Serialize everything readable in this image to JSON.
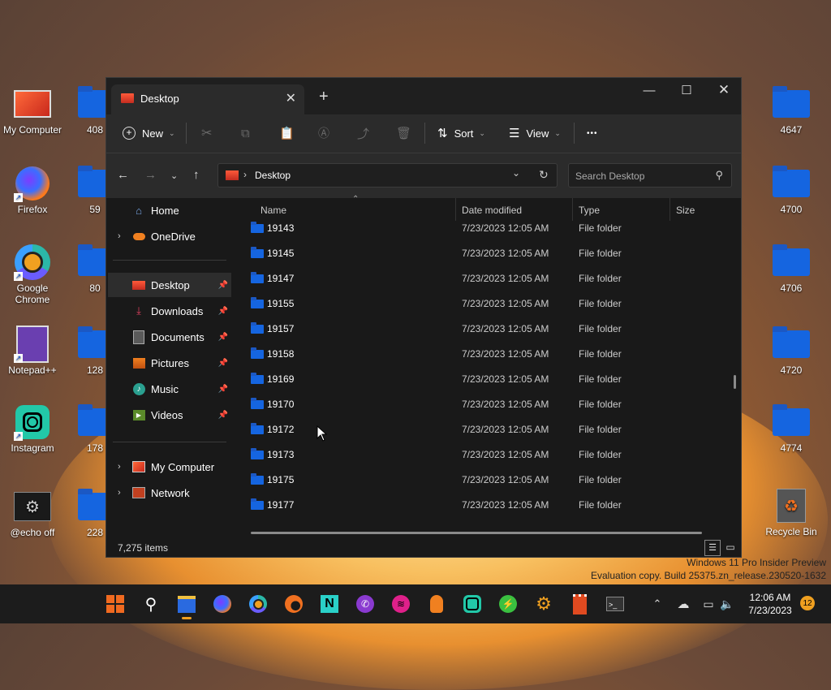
{
  "desktop": {
    "left_icons": [
      {
        "label": "My Computer"
      },
      {
        "label": "Firefox"
      },
      {
        "label": "Google Chrome"
      },
      {
        "label": "Notepad++"
      },
      {
        "label": "Instagram"
      },
      {
        "label": "@echo off"
      }
    ],
    "left_folders": [
      "408",
      "59",
      "80",
      "128",
      "178",
      "228"
    ],
    "right_folders": [
      "4647",
      "4700",
      "4706",
      "4720",
      "4774"
    ],
    "recycle_bin": "Recycle Bin",
    "watermark_line1": "Windows 11 Pro Insider Preview",
    "watermark_line2": "Evaluation copy. Build 25375.zn_release.230520-1632"
  },
  "explorer": {
    "tab_title": "Desktop",
    "toolbar": {
      "new": "New",
      "sort": "Sort",
      "view": "View",
      "more": "•••"
    },
    "address": {
      "location": "Desktop"
    },
    "search": {
      "placeholder": "Search Desktop"
    },
    "sidebar": {
      "home": "Home",
      "onedrive": "OneDrive",
      "quick": [
        "Desktop",
        "Downloads",
        "Documents",
        "Pictures",
        "Music",
        "Videos"
      ],
      "my_computer": "My Computer",
      "network": "Network"
    },
    "columns": {
      "name": "Name",
      "date": "Date modified",
      "type": "Type",
      "size": "Size"
    },
    "rows": [
      {
        "name": "19143",
        "date": "7/23/2023 12:05 AM",
        "type": "File folder"
      },
      {
        "name": "19145",
        "date": "7/23/2023 12:05 AM",
        "type": "File folder"
      },
      {
        "name": "19147",
        "date": "7/23/2023 12:05 AM",
        "type": "File folder"
      },
      {
        "name": "19155",
        "date": "7/23/2023 12:05 AM",
        "type": "File folder"
      },
      {
        "name": "19157",
        "date": "7/23/2023 12:05 AM",
        "type": "File folder"
      },
      {
        "name": "19158",
        "date": "7/23/2023 12:05 AM",
        "type": "File folder"
      },
      {
        "name": "19169",
        "date": "7/23/2023 12:05 AM",
        "type": "File folder"
      },
      {
        "name": "19170",
        "date": "7/23/2023 12:05 AM",
        "type": "File folder"
      },
      {
        "name": "19172",
        "date": "7/23/2023 12:05 AM",
        "type": "File folder"
      },
      {
        "name": "19173",
        "date": "7/23/2023 12:05 AM",
        "type": "File folder"
      },
      {
        "name": "19175",
        "date": "7/23/2023 12:05 AM",
        "type": "File folder"
      },
      {
        "name": "19177",
        "date": "7/23/2023 12:05 AM",
        "type": "File folder"
      }
    ],
    "status": {
      "count": "7,275 items"
    }
  },
  "taskbar": {
    "time": "12:06 AM",
    "date": "7/23/2023",
    "notifications": "12"
  },
  "colors": {
    "accent": "#f0a020",
    "folder": "#1565e0",
    "window_bg": "#191919"
  }
}
